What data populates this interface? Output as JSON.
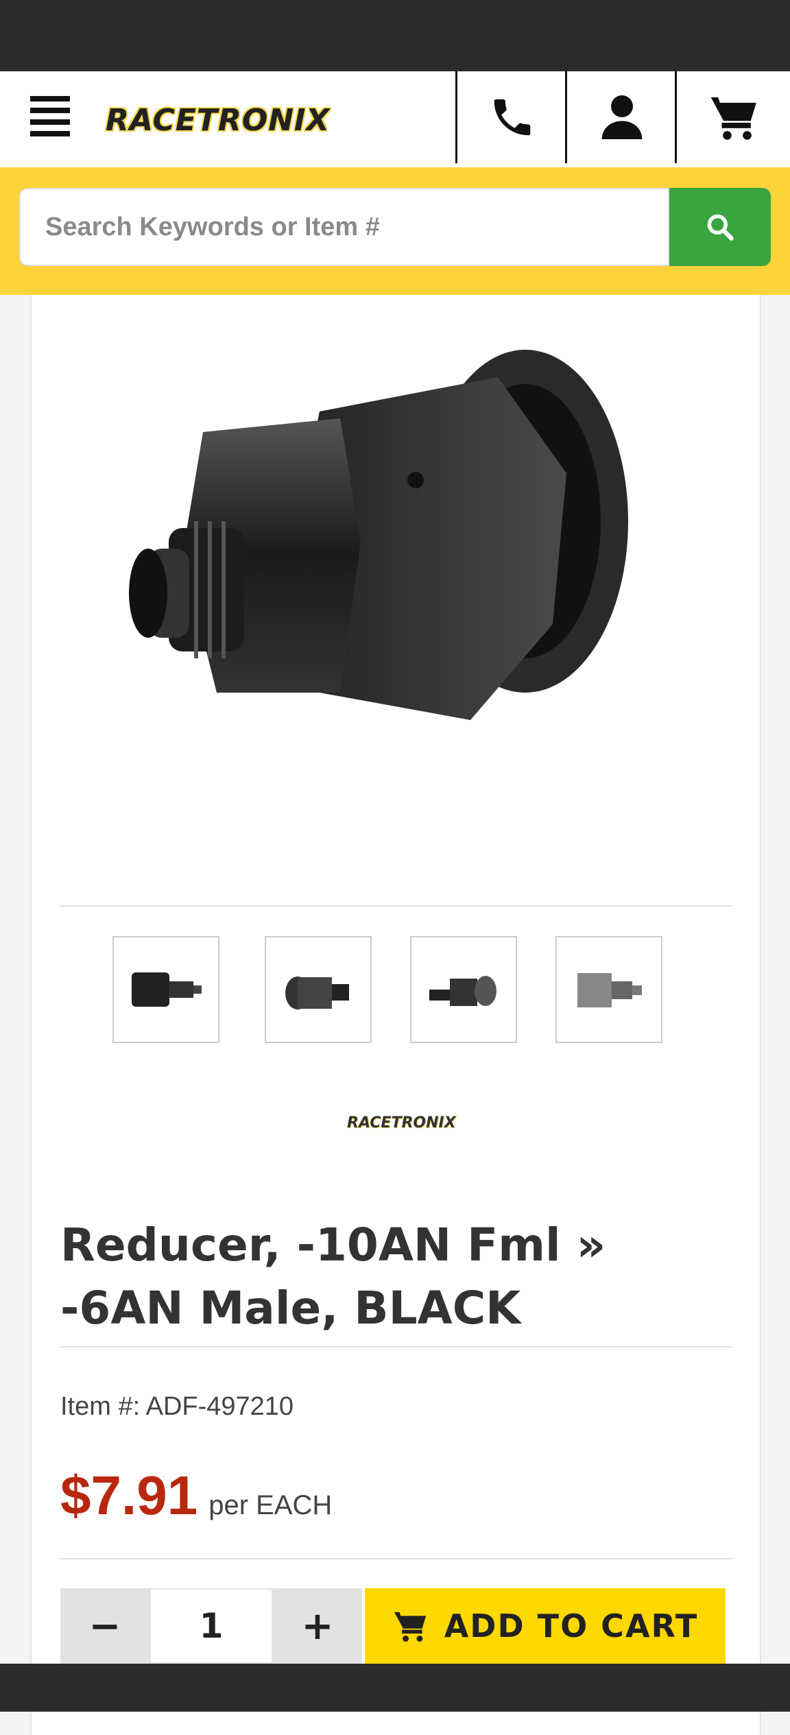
{
  "header": {
    "logo_text": "RACETRONIX",
    "icons": [
      "hamburger-menu-icon",
      "phone-icon",
      "account-icon",
      "cart-icon"
    ]
  },
  "search": {
    "placeholder": "Search Keywords or Item #",
    "icon": "search-icon"
  },
  "product": {
    "thumbnail_count": 4,
    "brand_logo_text": "RACETRONIX",
    "title": "Reducer, -10AN Fml » -6AN Male, BLACK",
    "item_label": "Item #: ADF-497210",
    "price": "$7.91",
    "price_unit": "per EACH"
  },
  "cart": {
    "minus_label": "−",
    "quantity": "1",
    "plus_label": "+",
    "add_label": "ADD TO CART"
  },
  "colors": {
    "accent_yellow": "#fdd33a",
    "search_green": "#3aa53e",
    "price_red": "#b8280f",
    "cart_button": "#ffd800"
  }
}
